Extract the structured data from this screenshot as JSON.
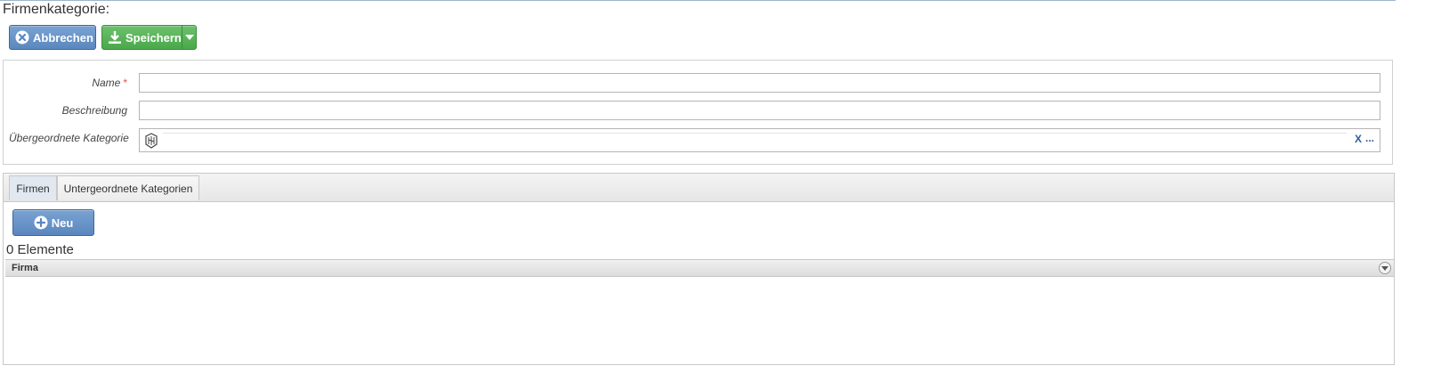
{
  "page": {
    "title": "Firmenkategorie:"
  },
  "toolbar": {
    "cancel_label": "Abbrechen",
    "save_label": "Speichern"
  },
  "form": {
    "name_label": "Name",
    "name_required": "*",
    "name_value": "",
    "description_label": "Beschreibung",
    "description_value": "",
    "parent_label": "Übergeordnete Kategorie",
    "parent_clear": "X",
    "parent_more": "..."
  },
  "tabs": [
    {
      "label": "Firmen"
    },
    {
      "label": "Untergeordnete Kategorien"
    }
  ],
  "list": {
    "new_label": "Neu",
    "count_text": "0 Elemente",
    "columns": [
      {
        "label": "Firma"
      }
    ],
    "rows": []
  },
  "colors": {
    "primary_button": "#5a87bf",
    "success_button": "#4aa84a",
    "required_marker": "#d9534f",
    "link": "#2e5f9e"
  },
  "icons": {
    "cancel": "close-circle-icon",
    "save": "download-icon",
    "dropdown": "caret-down-icon",
    "lookup": "category-lookup-icon",
    "new": "plus-circle-icon",
    "column_menu": "chevron-down-icon"
  }
}
